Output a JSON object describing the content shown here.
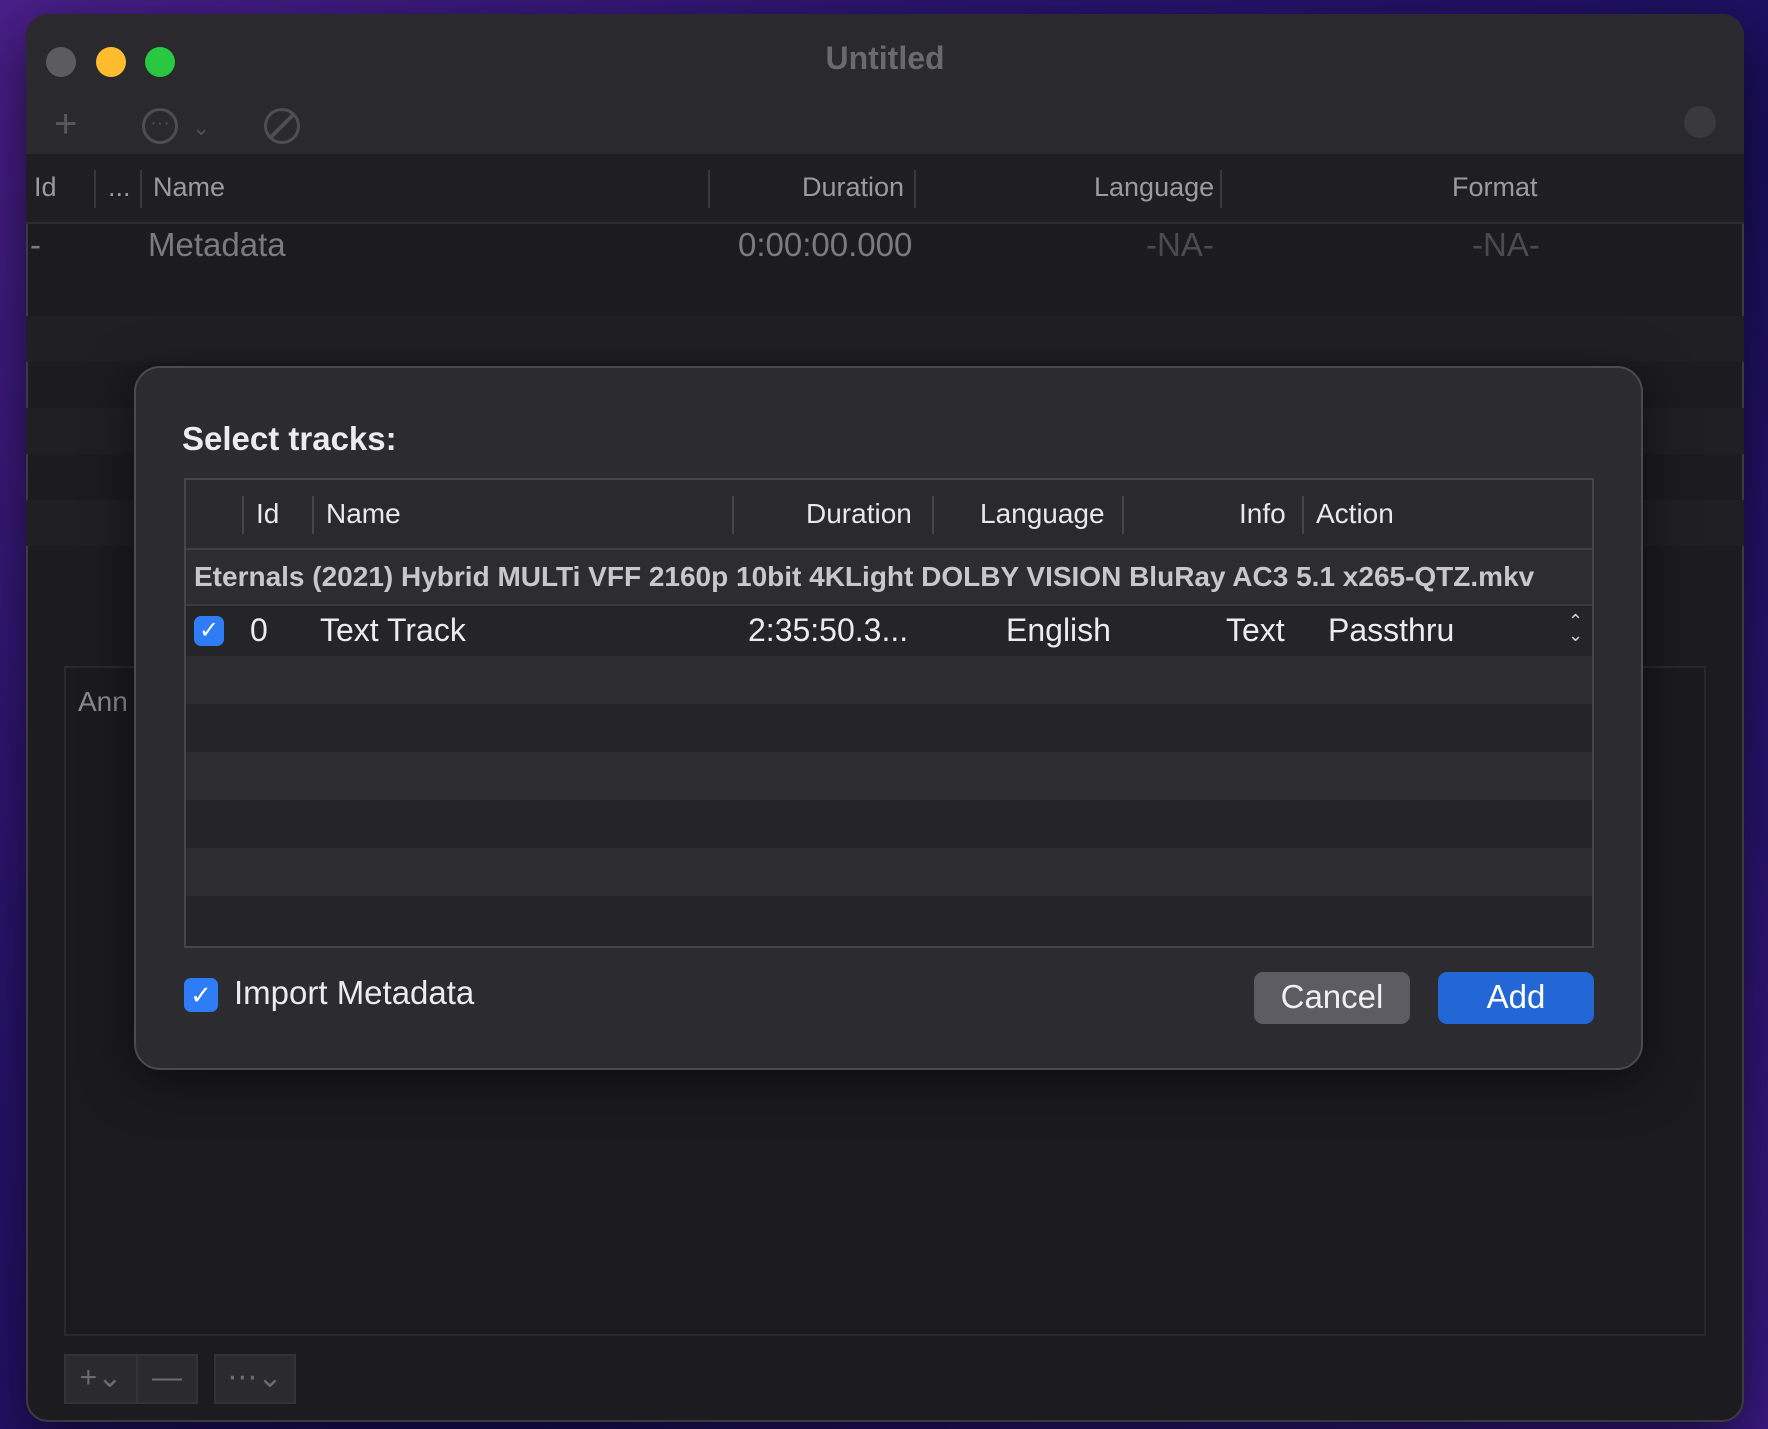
{
  "window": {
    "title": "Untitled"
  },
  "toolbar": {
    "icons": [
      "plus-icon",
      "more-icon",
      "chevron-down-icon",
      "block-icon",
      "search-icon"
    ]
  },
  "main_table": {
    "columns": [
      "Id",
      "...",
      "Name",
      "Duration",
      "Language",
      "Format"
    ],
    "rows": [
      {
        "id": "-",
        "name": "Metadata",
        "duration": "0:00:00.000",
        "language": "-NA-",
        "format": "-NA-"
      }
    ]
  },
  "annotations_tab": {
    "label": "Ann"
  },
  "sheet": {
    "title": "Select tracks:",
    "columns": {
      "id": "Id",
      "name": "Name",
      "duration": "Duration",
      "language": "Language",
      "info": "Info",
      "action": "Action"
    },
    "file_name": "Eternals (2021) Hybrid MULTi VFF 2160p 10bit 4KLight DOLBY VISION BluRay AC3 5.1 x265-QTZ.mkv",
    "tracks": [
      {
        "checked": true,
        "id": "0",
        "name": "Text Track",
        "duration": "2:35:50.3...",
        "language": "English",
        "info": "Text",
        "action": "Passthru"
      }
    ],
    "import_metadata": {
      "label": "Import Metadata",
      "checked": true
    },
    "cancel_label": "Cancel",
    "add_label": "Add",
    "accent_color": "#2367d6"
  }
}
